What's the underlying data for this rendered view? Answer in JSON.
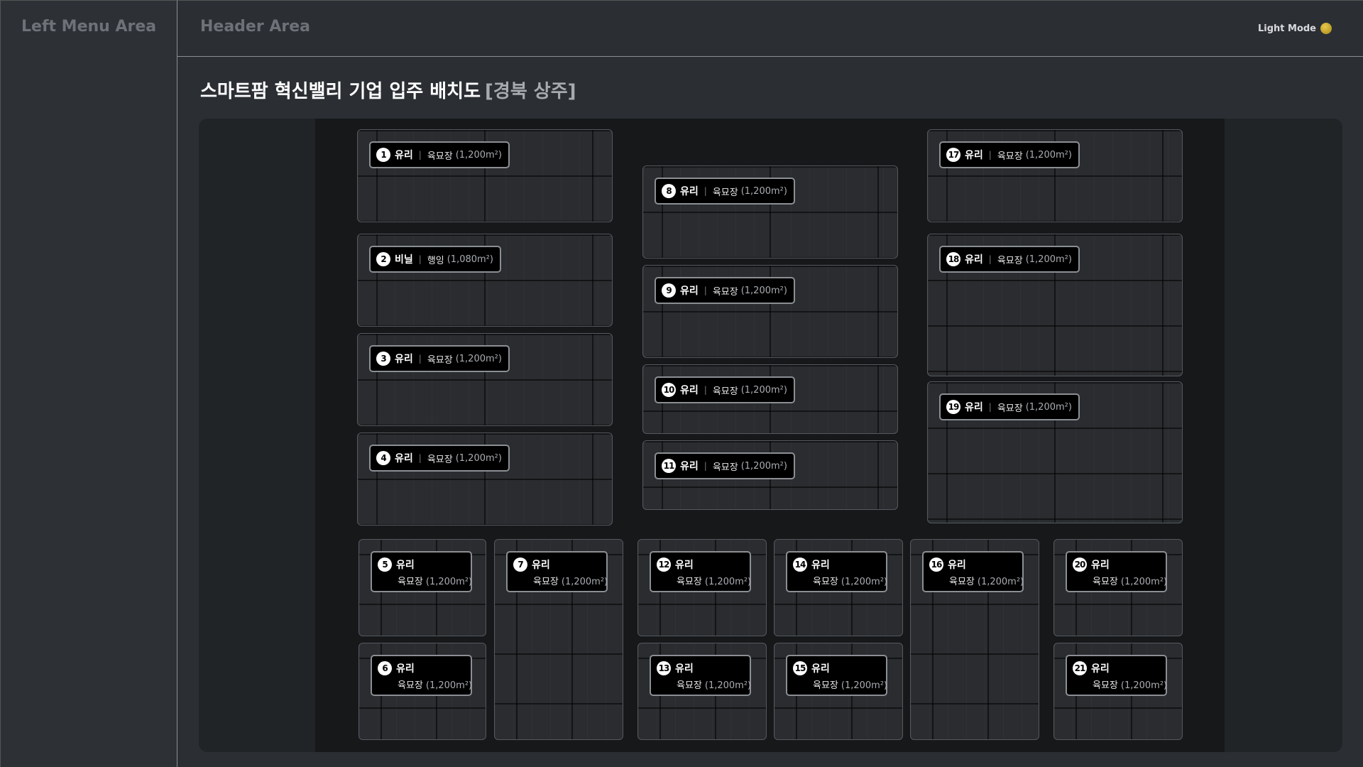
{
  "left_menu": {
    "title": "Left Menu Area"
  },
  "header": {
    "title": "Header Area",
    "mode_label": "Light Mode"
  },
  "page": {
    "title": "스마트팜 혁신밸리 기업 입주 배치도",
    "subtitle": "[경북 상주]"
  },
  "plots": [
    {
      "num": "1",
      "type": "유리",
      "use": "육묘장",
      "area": "(1,200m²)"
    },
    {
      "num": "2",
      "type": "비닐",
      "use": "행잉",
      "area": "(1,080m²)"
    },
    {
      "num": "3",
      "type": "유리",
      "use": "육묘장",
      "area": "(1,200m²)"
    },
    {
      "num": "4",
      "type": "유리",
      "use": "육묘장",
      "area": "(1,200m²)"
    },
    {
      "num": "5",
      "type": "유리",
      "use": "육묘장",
      "area": "(1,200m²)"
    },
    {
      "num": "6",
      "type": "유리",
      "use": "육묘장",
      "area": "(1,200m²)"
    },
    {
      "num": "7",
      "type": "유리",
      "use": "육묘장",
      "area": "(1,200m²)"
    },
    {
      "num": "8",
      "type": "유리",
      "use": "육묘장",
      "area": "(1,200m²)"
    },
    {
      "num": "9",
      "type": "유리",
      "use": "육묘장",
      "area": "(1,200m²)"
    },
    {
      "num": "10",
      "type": "유리",
      "use": "육묘장",
      "area": "(1,200m²)"
    },
    {
      "num": "11",
      "type": "유리",
      "use": "육묘장",
      "area": "(1,200m²)"
    },
    {
      "num": "12",
      "type": "유리",
      "use": "육묘장",
      "area": "(1,200m²)"
    },
    {
      "num": "13",
      "type": "유리",
      "use": "육묘장",
      "area": "(1,200m²)"
    },
    {
      "num": "14",
      "type": "유리",
      "use": "육묘장",
      "area": "(1,200m²)"
    },
    {
      "num": "15",
      "type": "유리",
      "use": "육묘장",
      "area": "(1,200m²)"
    },
    {
      "num": "16",
      "type": "유리",
      "use": "육묘장",
      "area": "(1,200m²)"
    },
    {
      "num": "17",
      "type": "유리",
      "use": "육묘장",
      "area": "(1,200m²)"
    },
    {
      "num": "18",
      "type": "유리",
      "use": "육묘장",
      "area": "(1,200m²)"
    },
    {
      "num": "19",
      "type": "유리",
      "use": "육묘장",
      "area": "(1,200m²)"
    },
    {
      "num": "20",
      "type": "유리",
      "use": "육묘장",
      "area": "(1,200m²)"
    },
    {
      "num": "21",
      "type": "유리",
      "use": "육묘장",
      "area": "(1,200m²)"
    }
  ]
}
